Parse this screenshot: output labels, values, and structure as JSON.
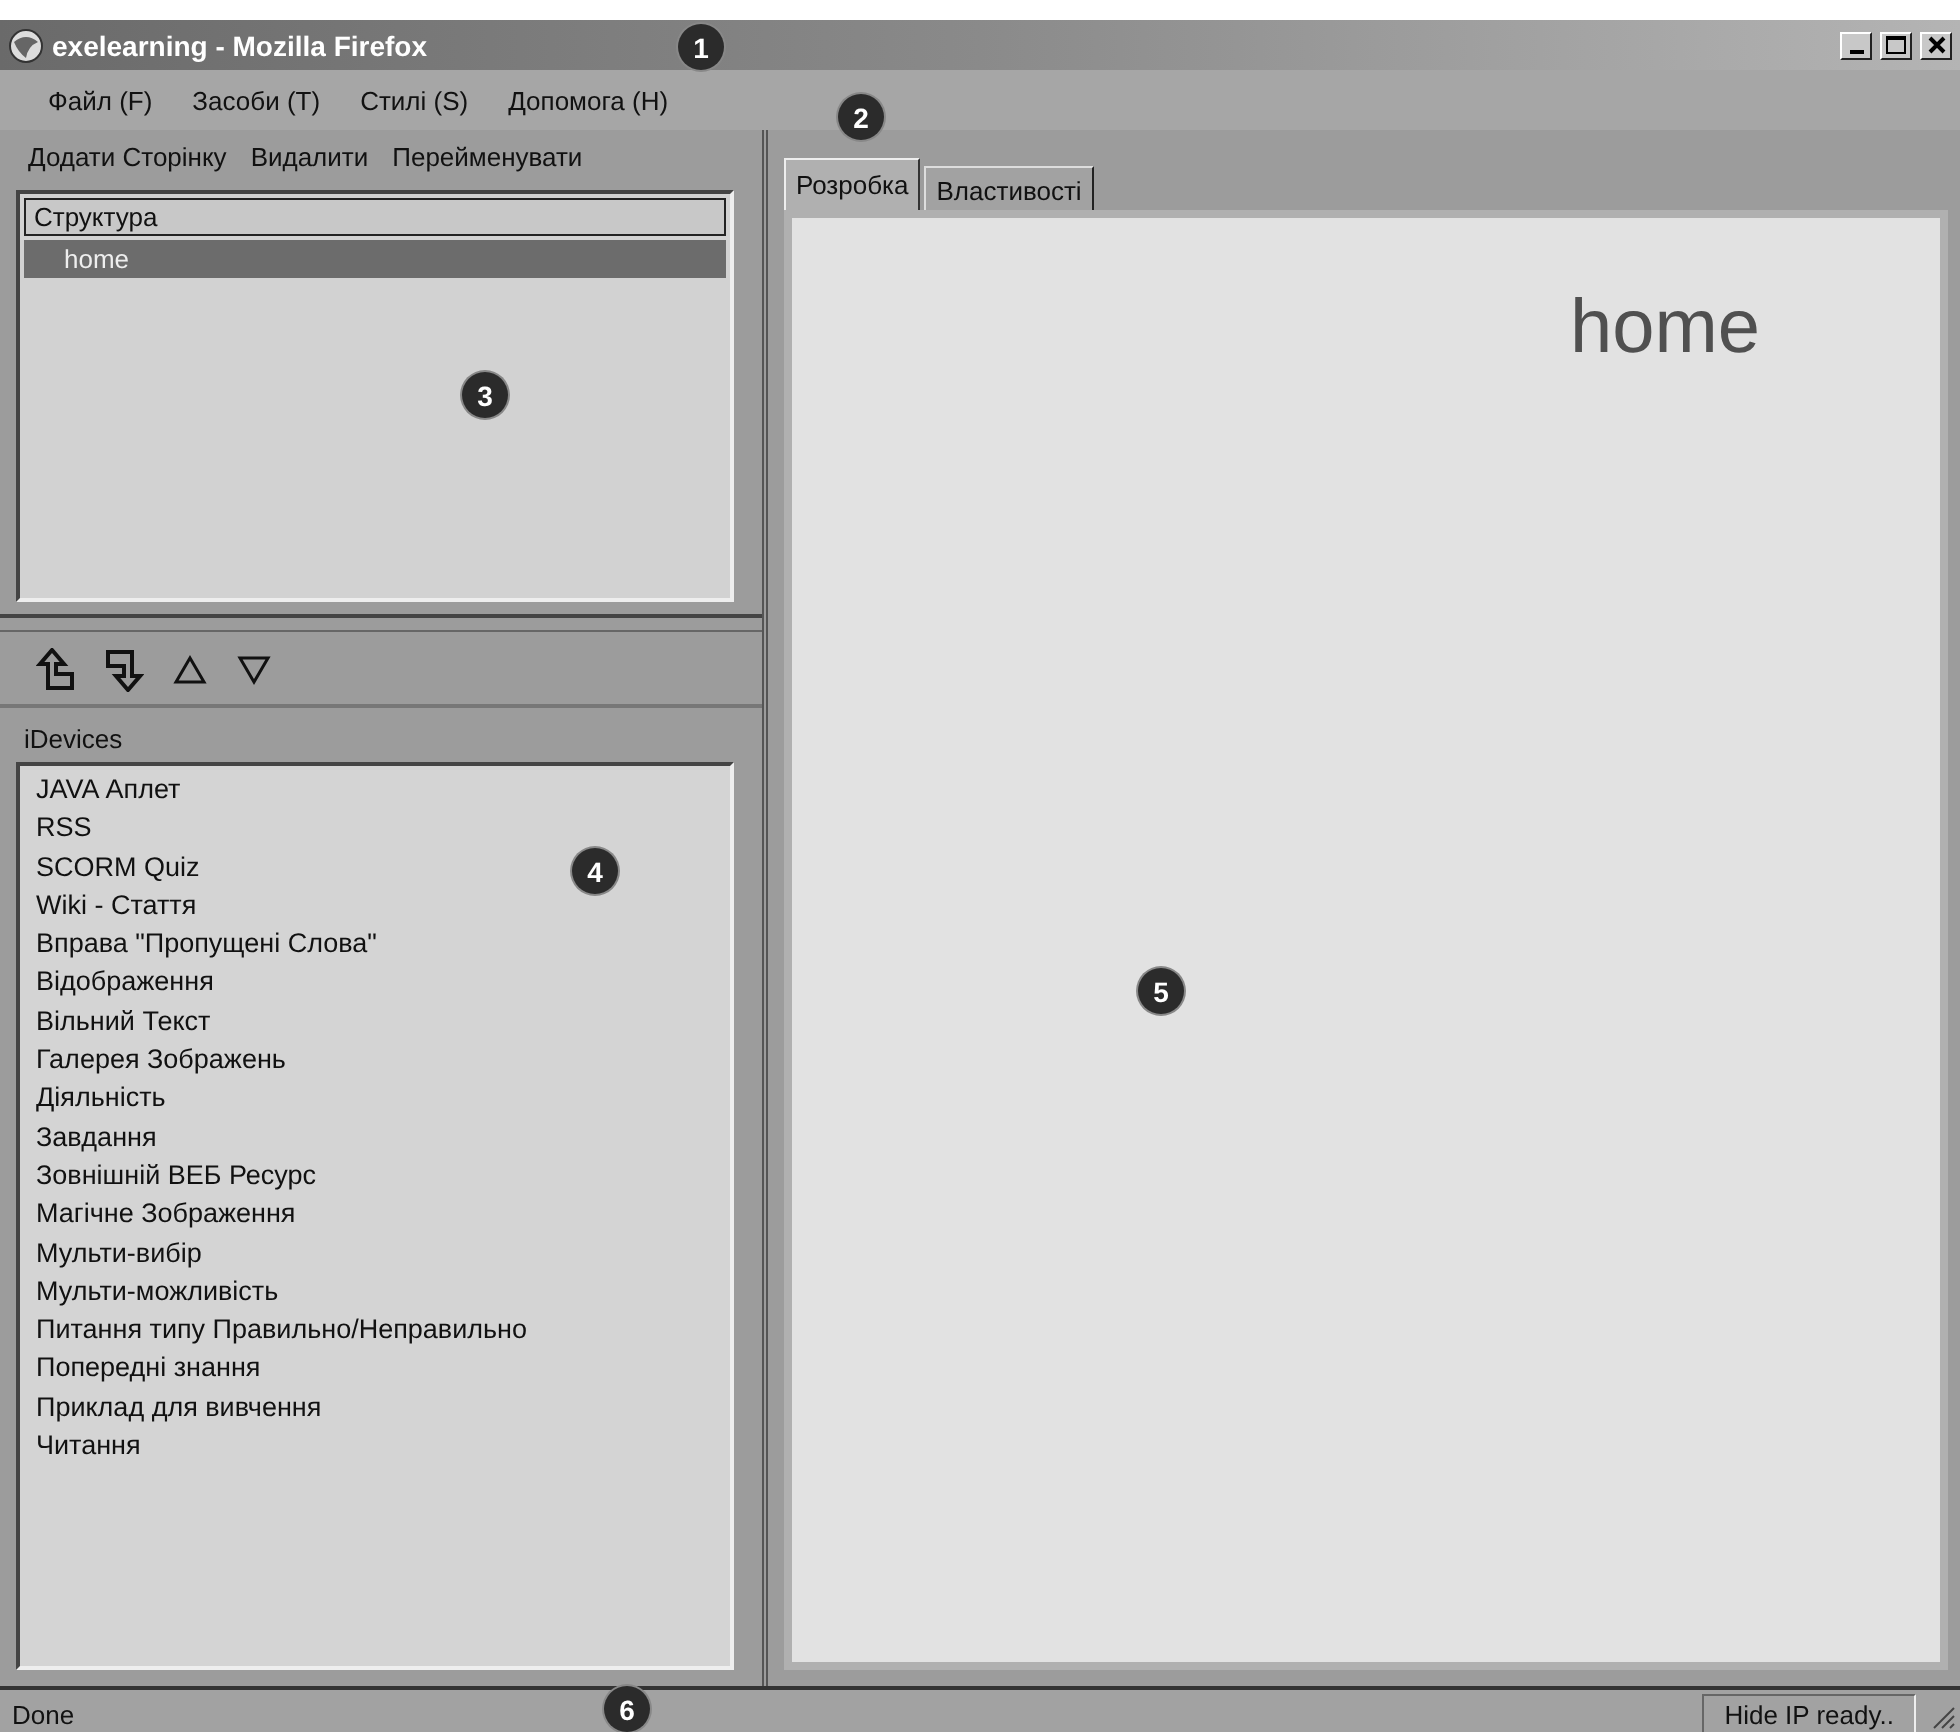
{
  "window": {
    "title": "exelearning - Mozilla Firefox"
  },
  "menu": [
    {
      "label": "Файл (F)"
    },
    {
      "label": "Засоби (T)"
    },
    {
      "label": "Стилі (S)"
    },
    {
      "label": "Допомога (H)"
    }
  ],
  "outline_toolbar": [
    "Додати Сторінку",
    "Видалити",
    "Перейменувати"
  ],
  "outline": {
    "header": "Структура",
    "items": [
      {
        "label": "home",
        "selected": true
      }
    ]
  },
  "idevices": {
    "title": "iDevices",
    "items": [
      "JAVA Аплет",
      "RSS",
      "SCORM Quiz",
      "Wiki - Стаття",
      "Вправа \"Пропущені Слова\"",
      "Відображення",
      "Вільний Текст",
      "Галерея Зображень",
      "Діяльність",
      "Завдання",
      "Зовнішній ВЕБ Ресурс",
      "Магічне Зображення",
      "Мульти-вибір",
      "Мульти-можливість",
      "Питання типу Правильно/Неправильно",
      "Попередні знання",
      "Приклад для вивчення",
      "Читання"
    ]
  },
  "tabs": [
    {
      "label": "Розробка",
      "selected": true
    },
    {
      "label": "Властивості",
      "selected": false
    }
  ],
  "page": {
    "title": "home"
  },
  "status_bar": {
    "text": "Done",
    "panel": "Hide IP ready.."
  },
  "callouts": [
    "1",
    "2",
    "3",
    "4",
    "5",
    "6"
  ]
}
